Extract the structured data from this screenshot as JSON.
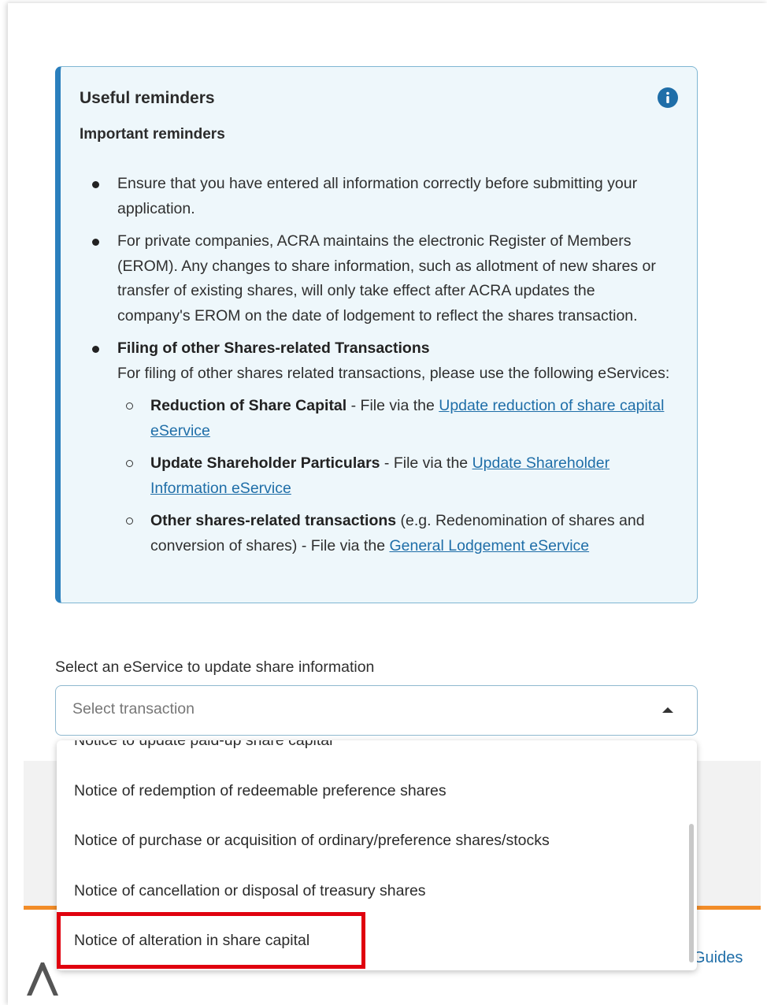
{
  "reminders": {
    "title": "Useful reminders",
    "subtitle": "Important reminders",
    "info_icon_color": "#1f6ea8",
    "bullet1": "Ensure that you have entered all information correctly before submitting your application.",
    "bullet2": "For private companies, ACRA maintains the electronic Register of Members (EROM). Any changes to share information, such as allotment of new shares or transfer of existing shares, will only take effect after ACRA updates the company's EROM on the date of lodgement to reflect the shares transaction.",
    "bullet3_title": "Filing of other Shares-related Transactions",
    "bullet3_text": "For filing of other shares related transactions, please use the following eServices:",
    "sub_items": [
      {
        "bold": "Reduction of Share Capital",
        "text": " - File via the ",
        "link": "Update reduction of share capital eService"
      },
      {
        "bold": "Update Shareholder Particulars",
        "text": " - File via the ",
        "link": "Update Shareholder Information eService"
      },
      {
        "bold": "Other shares-related transactions",
        "text": " (e.g. Redenomination of shares and conversion of shares) - File via the ",
        "link": "General Lodgement eService"
      }
    ]
  },
  "select": {
    "label": "Select an eService to update share information",
    "placeholder": "Select transaction"
  },
  "dropdown": {
    "options": [
      "Notice to update paid-up share capital",
      "Notice of redemption of redeemable preference shares",
      "Notice of purchase or acquisition of ordinary/preference shares/stocks",
      "Notice of cancellation or disposal of treasury shares",
      "Notice of alteration in share capital"
    ]
  },
  "background": {
    "guides_text": "Guides"
  },
  "colors": {
    "accent_blue": "#2a7fbd",
    "link": "#1f6ea8",
    "highlight": "#e0000e",
    "orange": "#f28c28"
  }
}
